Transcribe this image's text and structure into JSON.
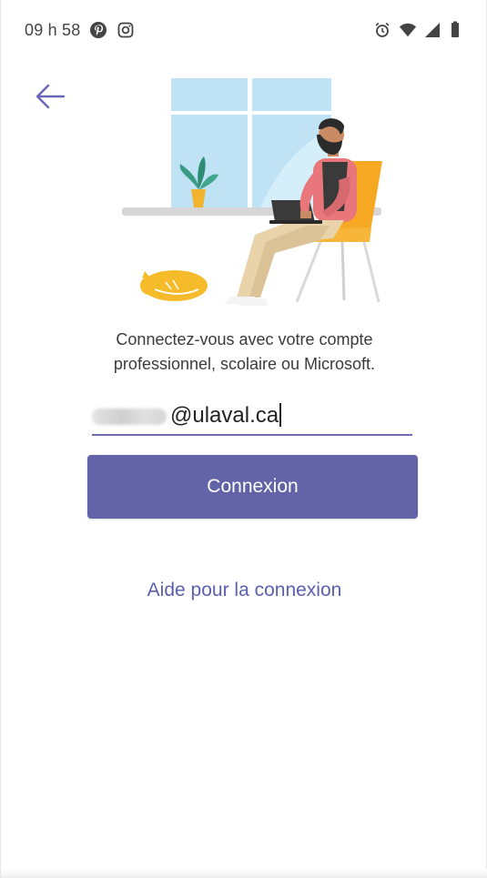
{
  "status_bar": {
    "time": "09 h 58",
    "left_icons": [
      "pinterest-icon",
      "instagram-icon"
    ],
    "right_icons": [
      "alarm-icon",
      "wifi-icon",
      "signal-icon",
      "battery-icon"
    ]
  },
  "nav": {
    "back_icon": "arrow-left-icon"
  },
  "illustration": {
    "description_icon": "person-working-laptop-illustration"
  },
  "prompt": {
    "line1": "Connectez-vous avec votre compte",
    "line2": "professionnel, scolaire ou Microsoft."
  },
  "email": {
    "value": "@ulaval.ca",
    "redacted_prefix": true
  },
  "buttons": {
    "connect_label": "Connexion"
  },
  "links": {
    "help_label": "Aide pour la connexion"
  },
  "colors": {
    "accent": "#6264a7",
    "link": "#5b5fb0",
    "underline": "#6f6bb5"
  }
}
